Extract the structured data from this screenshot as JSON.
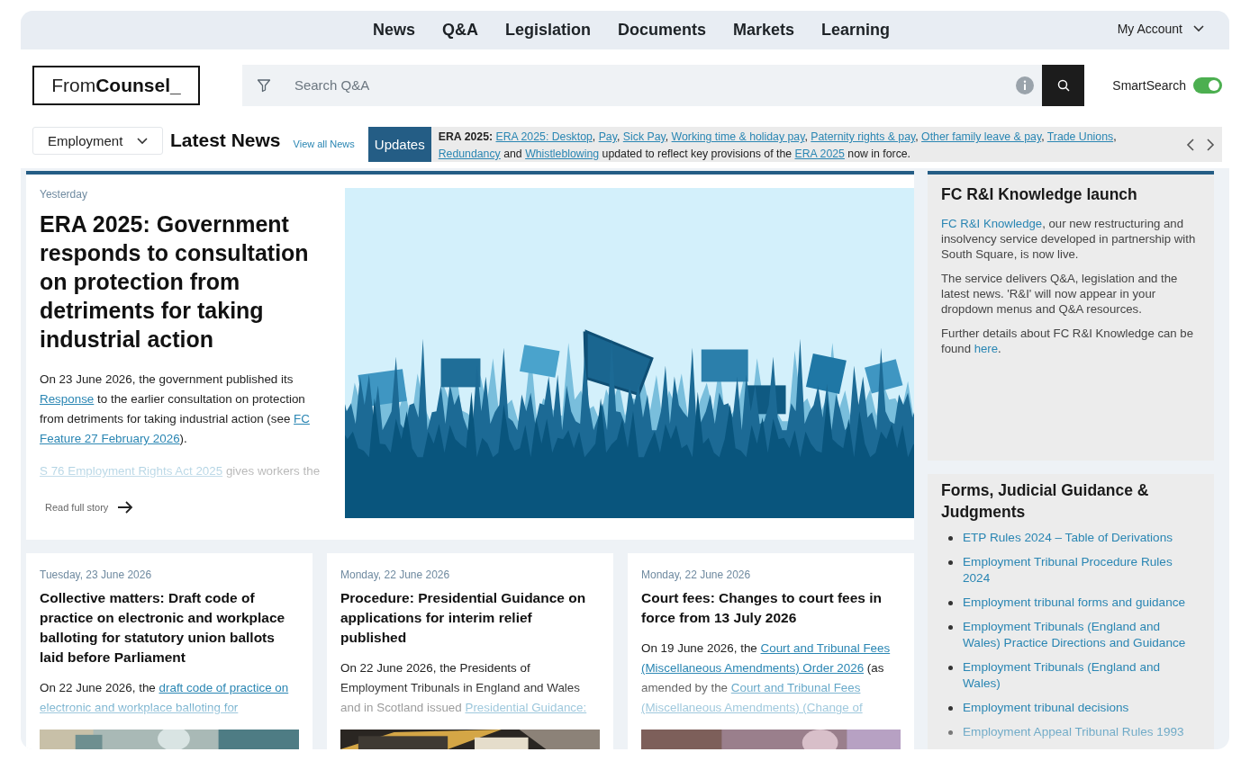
{
  "nav": {
    "items": [
      "News",
      "Q&A",
      "Legislation",
      "Documents",
      "Markets",
      "Learning"
    ],
    "account": "My Account"
  },
  "logo": {
    "light": "From",
    "bold": "Counsel_"
  },
  "search": {
    "placeholder": "Search Q&A"
  },
  "smart_search": {
    "label": "SmartSearch",
    "on": true
  },
  "practice_area": "Employment",
  "latest_news": {
    "title": "Latest News",
    "view_all": "View all News"
  },
  "ticker": {
    "label": "Updates",
    "segments": [
      {
        "kind": "bold",
        "text": "ERA 2025: "
      },
      {
        "kind": "link",
        "text": "ERA 2025: Desktop"
      },
      {
        "kind": "text",
        "text": ", "
      },
      {
        "kind": "link",
        "text": "Pay"
      },
      {
        "kind": "text",
        "text": ", "
      },
      {
        "kind": "link",
        "text": "Sick Pay"
      },
      {
        "kind": "text",
        "text": ", "
      },
      {
        "kind": "link",
        "text": "Working time & holiday pay"
      },
      {
        "kind": "text",
        "text": ", "
      },
      {
        "kind": "link",
        "text": "Paternity rights & pay"
      },
      {
        "kind": "text",
        "text": ", "
      },
      {
        "kind": "link",
        "text": "Other family leave & pay"
      },
      {
        "kind": "text",
        "text": ", "
      },
      {
        "kind": "link",
        "text": "Trade Unions"
      },
      {
        "kind": "text",
        "text": ", "
      },
      {
        "kind": "link",
        "text": "Redundancy"
      },
      {
        "kind": "text",
        "text": " and "
      },
      {
        "kind": "link",
        "text": "Whistleblowing"
      },
      {
        "kind": "text",
        "text": " updated to reflect key provisions of the "
      },
      {
        "kind": "link",
        "text": "ERA 2025"
      },
      {
        "kind": "text",
        "text": " now in force."
      }
    ]
  },
  "lead": {
    "date": "Yesterday",
    "title": "ERA 2025: Government responds to consultation on protection from detriments for taking industrial action",
    "paragraphs": [
      [
        {
          "kind": "text",
          "text": "On 23 June 2026, the government published its "
        },
        {
          "kind": "link",
          "text": "Response"
        },
        {
          "kind": "text",
          "text": " to the earlier consultation on protection from detriments for taking industrial action (see "
        },
        {
          "kind": "link",
          "lines": [
            "FC",
            "Feature 27 February 2026"
          ]
        },
        {
          "kind": "text",
          "text": ")."
        }
      ],
      [
        {
          "kind": "link",
          "text": "S 76 Employment Rights Act 2025"
        },
        {
          "kind": "text",
          "text": " gives workers the"
        }
      ]
    ],
    "read_more": "Read full story"
  },
  "cards": [
    {
      "date": "Tuesday, 23 June 2026",
      "title": "Collective matters: Draft code of practice on electronic and workplace balloting for statutory union ballots laid before Parliament",
      "excerpt": [
        {
          "kind": "text",
          "text": "On 22 June 2026, the "
        },
        {
          "kind": "link",
          "lines": [
            "draft code of practice on",
            "electronic and workplace balloting for"
          ]
        }
      ]
    },
    {
      "date": "Monday, 22 June 2026",
      "title": "Procedure: Presidential Guidance on applications for interim relief published",
      "excerpt": [
        {
          "kind": "text",
          "text": "On 22 June 2026, the Presidents of Employment Tribunals in England and Wales and in Scotland issued "
        },
        {
          "kind": "link",
          "text": "Presidential Guidance:"
        }
      ]
    },
    {
      "date": "Monday, 22 June 2026",
      "title": "Court fees: Changes to court fees in force from 13 July 2026",
      "excerpt": [
        {
          "kind": "text",
          "text": "On 19 June 2026, the "
        },
        {
          "kind": "link",
          "lines": [
            "Court and Tribunal Fees",
            "(Miscellaneous Amendments) Order 2026"
          ]
        },
        {
          "kind": "text",
          "text": " (as amended by the "
        },
        {
          "kind": "link",
          "lines": [
            "Court and Tribunal Fees",
            "(Miscellaneous Amendments) (Change of"
          ]
        }
      ]
    }
  ],
  "sidebar": [
    {
      "kind": "text",
      "title": "FC R&I Knowledge launch",
      "paragraphs": [
        [
          {
            "kind": "link",
            "text": "FC R&I Knowledge"
          },
          {
            "kind": "text",
            "text": ", our new restructuring and insolvency service developed in partnership with South Square, is now live."
          }
        ],
        [
          {
            "kind": "text",
            "text": "The service delivers Q&A, legislation and the latest news. 'R&I' will now appear in your dropdown menus and Q&A resources."
          }
        ],
        [
          {
            "kind": "text",
            "text": "Further details about FC R&I Knowledge can be found "
          },
          {
            "kind": "link",
            "text": "here"
          },
          {
            "kind": "text",
            "text": "."
          }
        ]
      ]
    },
    {
      "kind": "links",
      "title": "Forms, Judicial Guidance & Judgments",
      "links": [
        "ETP Rules 2024 – Table of Derivations",
        "Employment Tribunal Procedure Rules 2024",
        "Employment tribunal forms and guidance",
        "Employment Tribunals (England and Wales) Practice Directions and Guidance",
        "Employment Tribunals (England and Wales)",
        "Employment tribunal decisions",
        "Employment Appeal Tribunal Rules 1993"
      ]
    }
  ]
}
